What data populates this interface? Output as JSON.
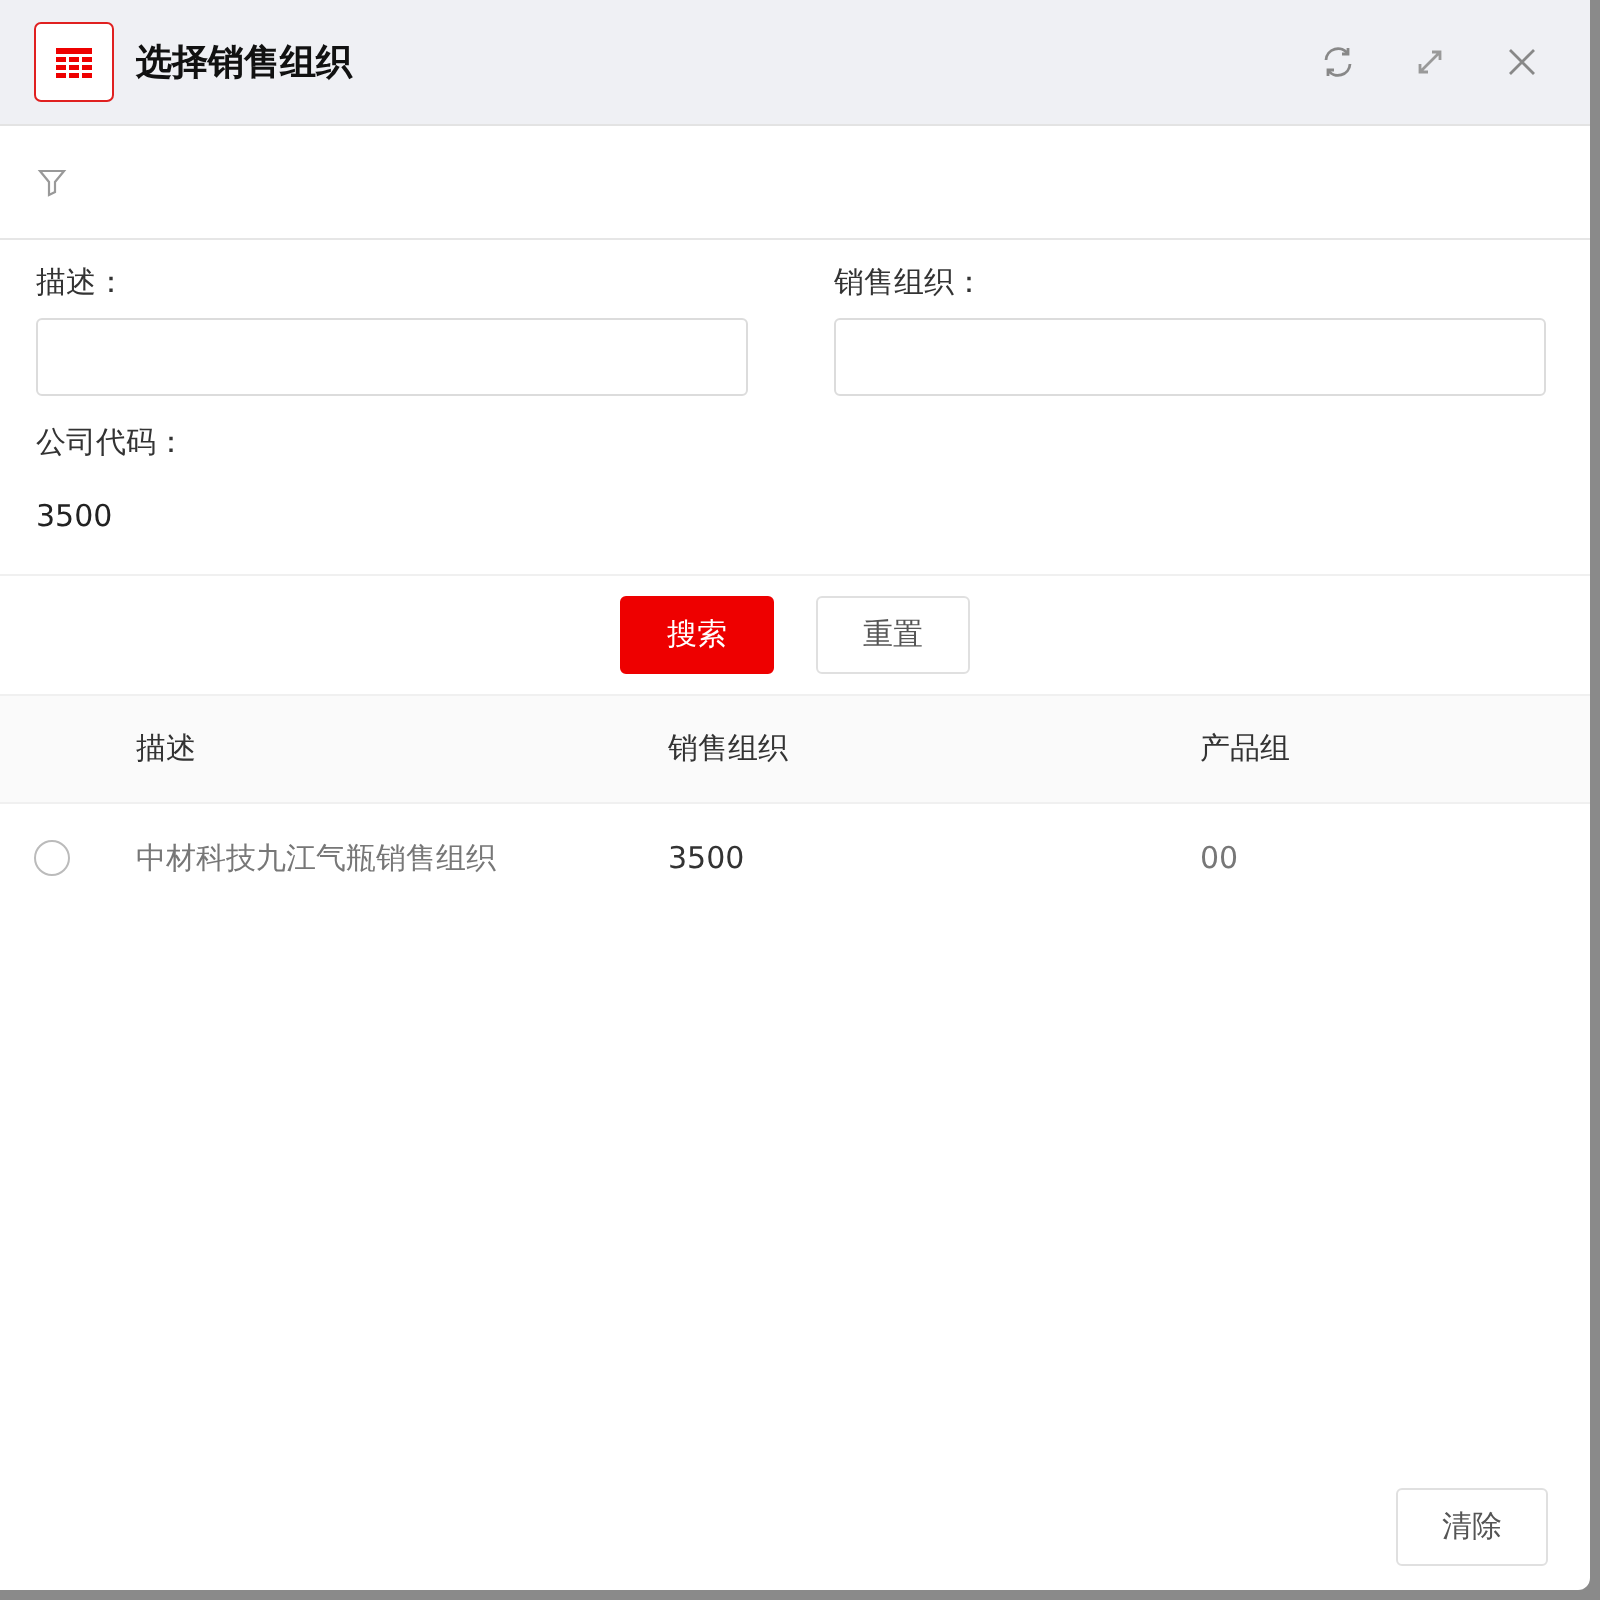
{
  "dialog": {
    "title": "选择销售组织"
  },
  "filter": {
    "fields": [
      {
        "label": "描述：",
        "kind": "input"
      },
      {
        "label": "销售组织：",
        "kind": "input"
      },
      {
        "label": "公司代码：",
        "kind": "text",
        "value": "3500"
      }
    ]
  },
  "actions": {
    "search": "搜索",
    "reset": "重置"
  },
  "table": {
    "columns": [
      "描述",
      "销售组织",
      "产品组"
    ],
    "rows": [
      {
        "selected": false,
        "cells": [
          "中材科技九江气瓶销售组织",
          "3500",
          "00"
        ]
      }
    ]
  },
  "footer": {
    "clear": "清除"
  }
}
